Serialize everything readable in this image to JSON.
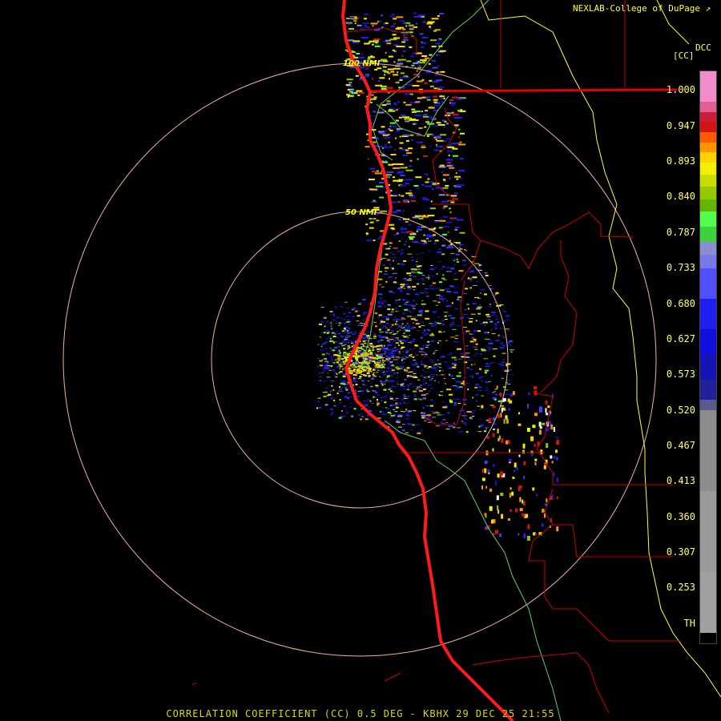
{
  "credit": "NEXLAB-College of DuPage",
  "credit_mark": "↗",
  "scale_title": "DCC",
  "scale_unit": "[CC]",
  "ring_labels": [
    "100 NMI",
    "50 NMI"
  ],
  "footer": "CORRELATION COEFFICIENT (CC) 0.5 DEG - KBHX 29 DEC 25 21:55",
  "scale_values": [
    "1.000",
    "0.947",
    "0.893",
    "0.840",
    "0.787",
    "0.733",
    "0.680",
    "0.627",
    "0.573",
    "0.520",
    "0.467",
    "0.413",
    "0.360",
    "0.307",
    "0.253",
    "TH"
  ],
  "colors": {
    "coastline": "#ff1a1a",
    "county_lines": "#cc0000",
    "state_lines": "#ffff33",
    "green_boundary": "#66cc66",
    "range_rings": "#f0b0a0",
    "label": "#ffff00"
  },
  "scale_colors": [
    "#f08cc8",
    "#e06096",
    "#c81e3c",
    "#d21414",
    "#ff5a00",
    "#ff9600",
    "#ffd200",
    "#f0f000",
    "#c8dc00",
    "#96c800",
    "#64b400",
    "#50ff50",
    "#3cd23c",
    "#8c8cd2",
    "#7878e6",
    "#5050ff",
    "#1e1ef0",
    "#1010dc",
    "#1414b4",
    "#202098",
    "#5a5a8c",
    "#8c8c8c",
    "#9a9a9a",
    "#a0a0a0",
    "#000000"
  ]
}
